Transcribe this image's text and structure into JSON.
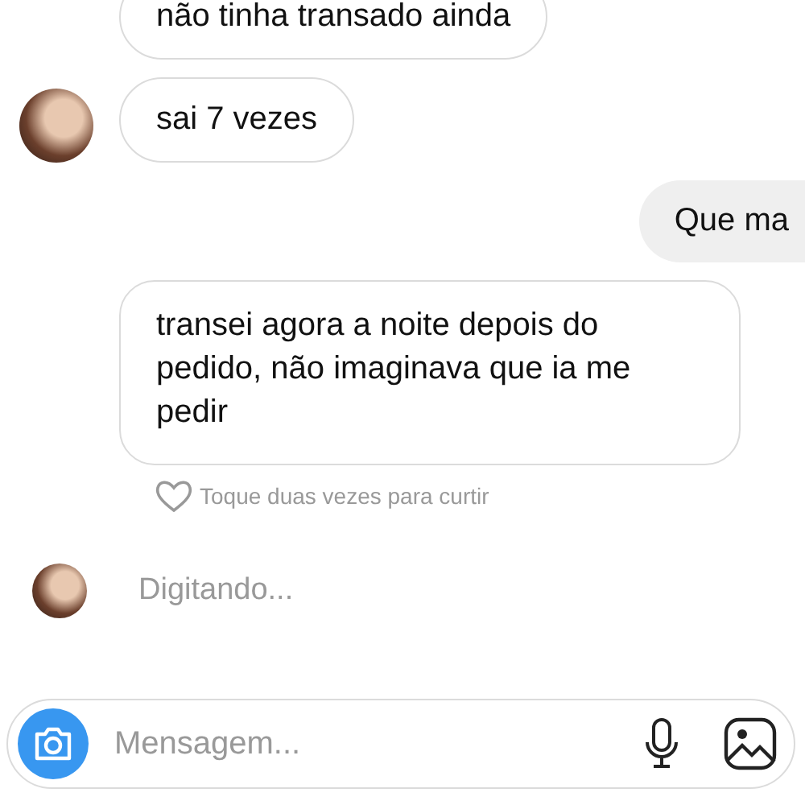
{
  "messages": [
    {
      "kind": "received",
      "text": "não tinha transado ainda",
      "avatar": false
    },
    {
      "kind": "received",
      "text": "sai 7 vezes",
      "avatar": true
    },
    {
      "kind": "sent",
      "text": "Que ma",
      "avatar": false
    },
    {
      "kind": "received",
      "text": "transei agora a noite depois do pedido, não imaginava que ia me pedir",
      "avatar": false,
      "liked": false,
      "like_hint": "Toque duas vezes para curtir"
    }
  ],
  "typing": {
    "text": "Digitando..."
  },
  "composer": {
    "placeholder": "Mensagem..."
  }
}
